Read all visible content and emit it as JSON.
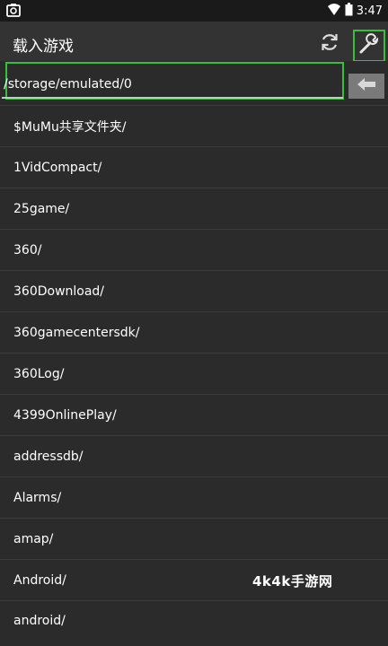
{
  "status_bar": {
    "time": "3:47"
  },
  "app_bar": {
    "title": "载入游戏"
  },
  "path": {
    "value": "/storage/emulated/0"
  },
  "files": [
    "$MuMu共享文件夹/",
    "1VidCompact/",
    "25game/",
    "360/",
    "360Download/",
    "360gamecentersdk/",
    "360Log/",
    "4399OnlinePlay/",
    "addressdb/",
    "Alarms/",
    "amap/",
    "Android/",
    "android/"
  ],
  "watermark": "4k4k手游网",
  "colors": {
    "accent": "#35c03a",
    "background": "#2b2b2b",
    "app_bar": "#333333"
  },
  "icons": {
    "status_left": "screenshot-icon",
    "wifi": "wifi-icon",
    "battery": "battery-icon",
    "refresh": "refresh-icon",
    "settings": "wrench-icon",
    "back": "arrow-left-icon"
  }
}
